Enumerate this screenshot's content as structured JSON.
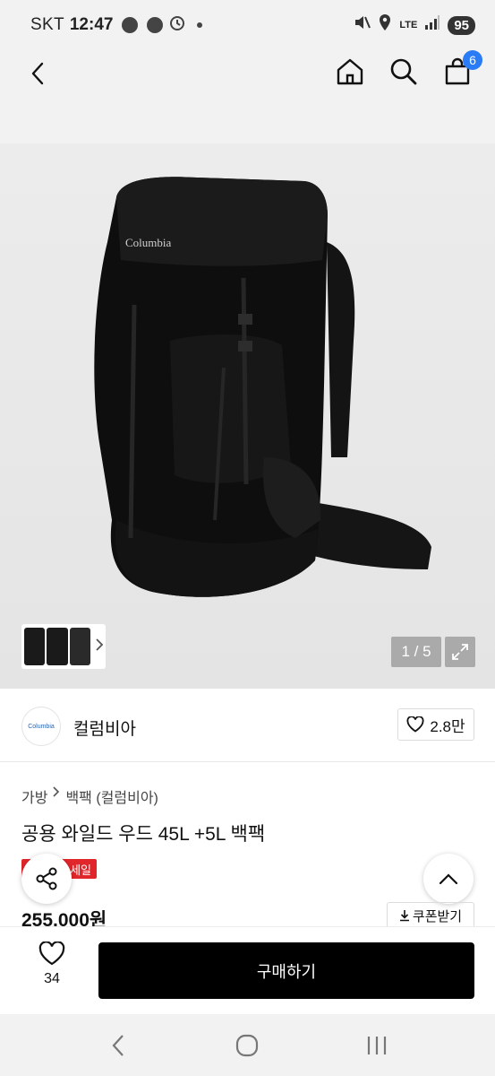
{
  "status": {
    "carrier": "SKT",
    "time": "12:47",
    "network": "LTE",
    "battery": "95"
  },
  "header": {
    "cart_count": "6"
  },
  "gallery": {
    "brand_on_bag": "Columbia",
    "counter": "1 / 5"
  },
  "brand": {
    "logo_text": "Columbia",
    "name": "컬럼비아",
    "likes": "2.8만"
  },
  "breadcrumb": {
    "items": [
      "가방",
      "백팩 (컬럼비아)"
    ]
  },
  "product": {
    "title": "공용 와일드 우드 45L +5L 백팩",
    "badge": "세일",
    "price": "255,000원",
    "coupon_label": "쿠폰받기"
  },
  "purchase": {
    "wish_count": "34",
    "buy_label": "구매하기"
  },
  "colors": {
    "accent_blue": "#2a7bf6",
    "sale_red": "#e0262a",
    "buy_black": "#000000"
  }
}
